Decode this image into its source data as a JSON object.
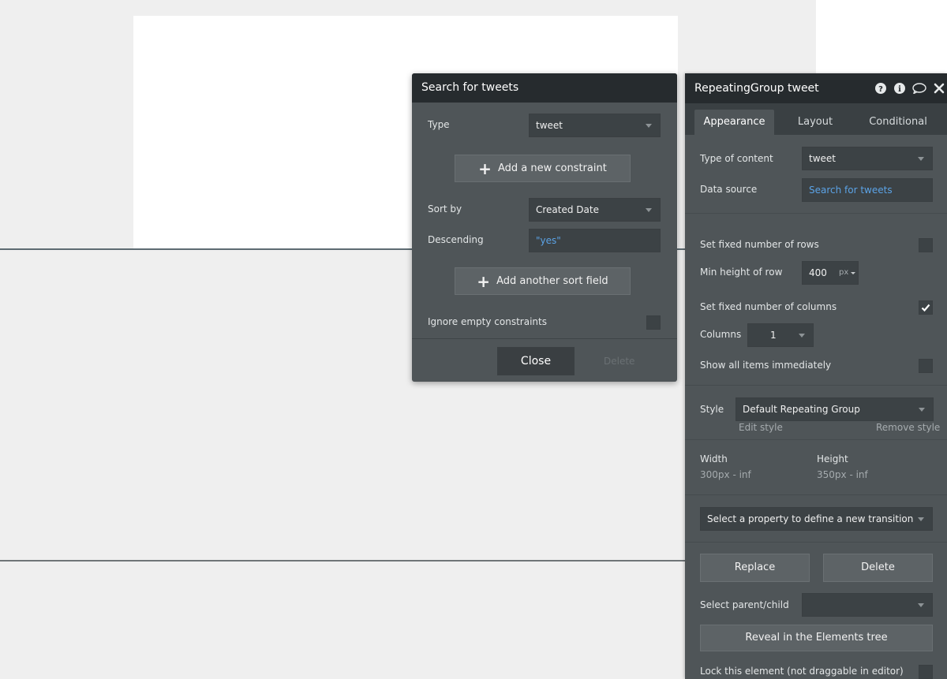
{
  "popup": {
    "title": "Search for tweets",
    "type_label": "Type",
    "type_value": "tweet",
    "add_constraint_label": "Add a new constraint",
    "sort_by_label": "Sort by",
    "sort_by_value": "Created Date",
    "descending_label": "Descending",
    "descending_value": "\"yes\"",
    "add_sort_label": "Add another sort field",
    "ignore_empty_label": "Ignore empty constraints",
    "ignore_empty_checked": false,
    "close_label": "Close",
    "delete_label": "Delete"
  },
  "editor": {
    "title": "RepeatingGroup tweet",
    "header_icons": [
      "help-icon",
      "info-icon",
      "comment-icon",
      "close-icon"
    ],
    "tabs": [
      {
        "label": "Appearance",
        "active": true
      },
      {
        "label": "Layout",
        "active": false
      },
      {
        "label": "Conditional",
        "active": false
      }
    ],
    "type_of_content_label": "Type of content",
    "type_of_content_value": "tweet",
    "data_source_label": "Data source",
    "data_source_value": "Search for tweets",
    "fixed_rows_label": "Set fixed number of rows",
    "fixed_rows_checked": false,
    "min_height_label": "Min height of row",
    "min_height_value": "400",
    "min_height_unit": "px",
    "fixed_columns_label": "Set fixed number of columns",
    "fixed_columns_checked": true,
    "columns_label": "Columns",
    "columns_value": "1",
    "show_all_label": "Show all items immediately",
    "show_all_checked": false,
    "style_label": "Style",
    "style_value": "Default Repeating Group",
    "edit_style_label": "Edit style",
    "remove_style_label": "Remove style",
    "width_label": "Width",
    "width_value": "300px - inf",
    "height_label": "Height",
    "height_value": "350px - inf",
    "transition_placeholder": "Select a property to define a new transition",
    "replace_label": "Replace",
    "delete_label": "Delete",
    "parent_child_label": "Select parent/child",
    "reveal_label": "Reveal in the Elements tree",
    "lock_label": "Lock this element (not draggable in editor)"
  },
  "colors": {
    "panel_bg": "#4f5558",
    "header_bg": "#262b2e",
    "field_bg": "#3c4245",
    "link": "#5ba3e6"
  }
}
